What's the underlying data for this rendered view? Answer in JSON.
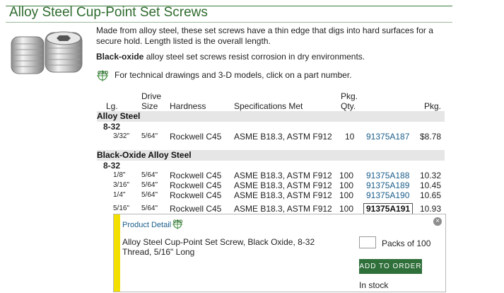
{
  "title": "Alloy Steel Cup-Point Set Screws",
  "description": "Made from alloy steel, these set screws have a thin edge that digs into hard surfaces for a secure hold. Length listed is the overall length.",
  "black_oxide_note": {
    "bold": "Black-oxide",
    "rest": " alloy steel set screws resist corrosion in dry environments."
  },
  "cad_note": "For technical drawings and 3-D models, click on a part number.",
  "cad_icon_text": "CAD",
  "headers": {
    "lg": "Lg.",
    "drive_line1": "Drive",
    "drive_line2": "Size",
    "hardness": "Hardness",
    "specs": "Specifications Met",
    "pkg_qty_line1": "Pkg.",
    "pkg_qty_line2": "Qty.",
    "pkg": "Pkg."
  },
  "sections": [
    {
      "name": "Alloy Steel",
      "thread": "8-32",
      "rows": [
        {
          "lg": "3/32\"",
          "drive": "5/64\"",
          "hardness": "Rockwell C45",
          "specs": "ASME B18.3, ASTM F912",
          "qty": "10",
          "part": "91375A187",
          "price": "$8.78"
        }
      ]
    },
    {
      "name": "Black-Oxide Alloy Steel",
      "thread": "8-32",
      "rows": [
        {
          "lg": "1/8\"",
          "drive": "5/64\"",
          "hardness": "Rockwell C45",
          "specs": "ASME B18.3, ASTM F912",
          "qty": "100",
          "part": "91375A188",
          "price": "10.32"
        },
        {
          "lg": "3/16\"",
          "drive": "5/64\"",
          "hardness": "Rockwell C45",
          "specs": "ASME B18.3, ASTM F912",
          "qty": "100",
          "part": "91375A189",
          "price": "10.45"
        },
        {
          "lg": "1/4\"",
          "drive": "5/64\"",
          "hardness": "Rockwell C45",
          "specs": "ASME B18.3, ASTM F912",
          "qty": "100",
          "part": "91375A190",
          "price": "10.65"
        },
        {
          "lg": "5/16\"",
          "drive": "5/64\"",
          "hardness": "Rockwell C45",
          "specs": "ASME B18.3, ASTM F912",
          "qty": "100",
          "part": "91375A191",
          "price": "10.93"
        }
      ]
    }
  ],
  "detail": {
    "link": "Product Detail",
    "close": "×",
    "description": "Alloy Steel Cup-Point Set Screw, Black Oxide, 8-32 Thread, 5/16\" Long",
    "qty_value": "",
    "packs_label": "Packs of 100",
    "add_button": "ADD TO ORDER",
    "stock": "In stock"
  },
  "colors": {
    "title": "#2e6b2e",
    "link": "#1a5d8a",
    "band": "#e6e6e6",
    "accent_bar": "#f3e000",
    "button": "#2f6f3a"
  }
}
